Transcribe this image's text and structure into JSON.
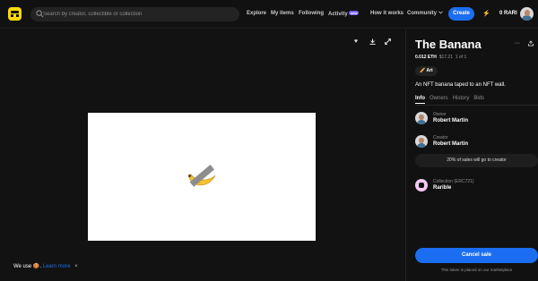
{
  "header": {
    "search_placeholder": "Search by creator, collectible or collection",
    "nav": {
      "explore": "Explore",
      "my_items": "My items",
      "following": "Following",
      "activity": "Activity",
      "activity_badge": "new",
      "how_it_works": "How it works",
      "community": "Community"
    },
    "create_label": "Create",
    "balance": "0 RARI",
    "icons": {
      "logo": "rarible-logo-icon",
      "search": "search-icon",
      "bolt": "bolt-icon",
      "chevron": "chevron-down-icon"
    }
  },
  "viewer": {
    "icons": {
      "like": "heart-icon",
      "download": "download-icon",
      "expand": "expand-icon"
    },
    "artwork": "banana-taped-artwork"
  },
  "cookie": {
    "prefix": "We use",
    "emoji": "🍪",
    "separator": ".",
    "link": "Learn more",
    "close": "×"
  },
  "item": {
    "title": "The Banana",
    "price": "0.012 ETH",
    "price_usd": "$17.21",
    "edition": "1 of 1",
    "category_emoji": "🥖",
    "category": "Art",
    "description": "An NFT banana taped to an NFT wall.",
    "tabs": [
      "Info",
      "Owners",
      "History",
      "Bids"
    ],
    "owner_label": "Owner",
    "owner_name": "Robert Martin",
    "creator_label": "Creator",
    "creator_name": "Robert Martin",
    "royalty_text": "20% of sales will go to creator",
    "collection_label": "Collection (ERC721)",
    "collection_name": "Rarible",
    "cancel_label": "Cancel sale",
    "note": "This token is placed on our marketplace",
    "icons": {
      "more": "more-icon",
      "share": "share-icon"
    }
  },
  "colors": {
    "accent": "#1b6ef2",
    "logo": "#feda03",
    "badge": "#7b61ff",
    "background": "#0f0f0f"
  }
}
